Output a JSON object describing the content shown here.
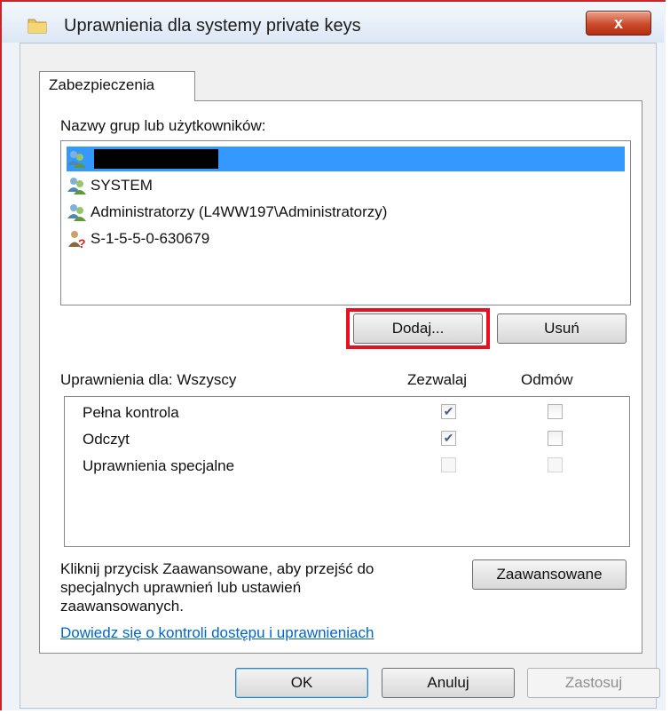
{
  "window": {
    "title": "Uprawnienia dla systemy private keys",
    "close_glyph": "x"
  },
  "tabs": [
    {
      "label": "Zabezpieczenia",
      "active": true
    }
  ],
  "groups": {
    "label": "Nazwy grup lub użytkowników:",
    "items": [
      {
        "label": "",
        "icon": "users-group-icon",
        "selected": true,
        "redacted": true
      },
      {
        "label": "SYSTEM",
        "icon": "users-group-icon",
        "selected": false
      },
      {
        "label": "Administratorzy (L4WW197\\Administratorzy)",
        "icon": "users-group-icon",
        "selected": false
      },
      {
        "label": "S-1-5-5-0-630679",
        "icon": "unknown-user-icon",
        "selected": false
      }
    ],
    "add_button": "Dodaj...",
    "remove_button": "Usuń"
  },
  "permissions": {
    "label": "Uprawnienia dla: Wszyscy",
    "allow_header": "Zezwalaj",
    "deny_header": "Odmów",
    "rows": [
      {
        "name": "Pełna kontrola",
        "allow": true,
        "deny": false,
        "enabled": true
      },
      {
        "name": "Odczyt",
        "allow": true,
        "deny": false,
        "enabled": true
      },
      {
        "name": "Uprawnienia specjalne",
        "allow": false,
        "deny": false,
        "enabled": false
      }
    ]
  },
  "advanced": {
    "text_line1": "Kliknij przycisk Zaawansowane, aby przejść do",
    "text_line2": "specjalnych uprawnień lub ustawień",
    "text_line3": "zaawansowanych.",
    "button": "Zaawansowane"
  },
  "help_link": "Dowiedz się o kontroli dostępu i uprawnieniach",
  "footer": {
    "ok": "OK",
    "cancel": "Anuluj",
    "apply": "Zastosuj"
  },
  "colors": {
    "selection": "#3399ff",
    "highlight": "#e8101e",
    "link": "#0066cc"
  }
}
